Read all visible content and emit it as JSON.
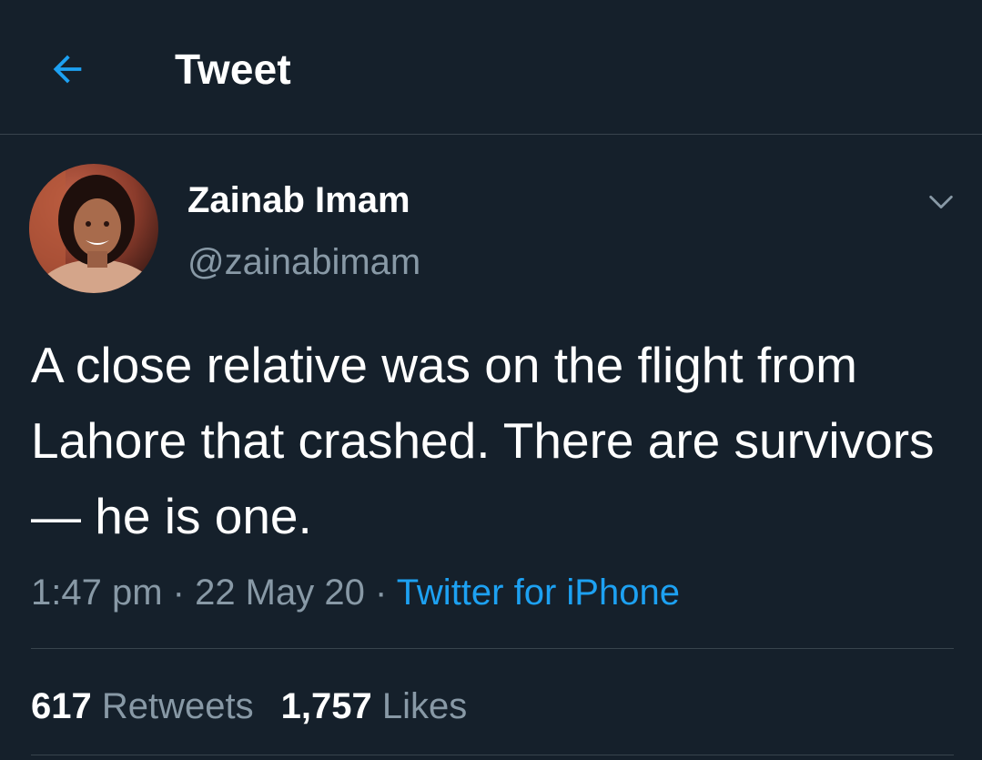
{
  "header": {
    "title": "Tweet",
    "back_icon": "arrow-left-icon"
  },
  "author": {
    "name": "Zainab Imam",
    "handle": "@zainabimam",
    "avatar_icon": "profile-photo"
  },
  "tweet": {
    "text": "A close relative was on the flight from Lahore that crashed. There are survivors — he is one.",
    "time": "1:47 pm",
    "date": "22 May 20",
    "separator": " · ",
    "source": "Twitter for iPhone"
  },
  "stats": {
    "retweets_count": "617",
    "retweets_label": "Retweets",
    "likes_count": "1,757",
    "likes_label": "Likes"
  },
  "colors": {
    "background": "#15202b",
    "accent": "#1da1f2",
    "secondary_text": "#8899a6",
    "divider": "#38444d"
  }
}
